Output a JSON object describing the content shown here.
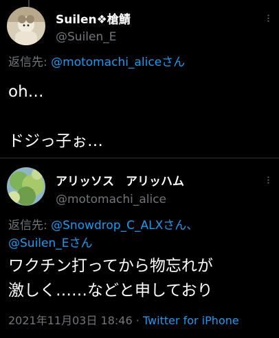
{
  "tweets": [
    {
      "display_name": "Suilen❖槍鯖",
      "handle": "@Suilen_E",
      "reply_prefix": "返信先: ",
      "reply_mentions": [
        "@motomachi_aliceさん"
      ],
      "body_lines": [
        "oh…",
        "",
        "ドジっ子ぉ…"
      ],
      "more": "···"
    },
    {
      "display_name": "アリッソス　アリッハム",
      "handle": "@motomachi_alice",
      "reply_prefix": "返信先: ",
      "reply_mentions": [
        "@Snowdrop_C_ALXさん、",
        "@Suilen_Eさん"
      ],
      "body_lines": [
        "ワクチン打ってから物忘れが",
        "激しく……などと申しており"
      ],
      "timestamp": "2021年11月03日 18:46",
      "separator": " · ",
      "source": "Twitter for iPhone",
      "more": "···"
    }
  ],
  "colors": {
    "background": "#000000",
    "text": "#ffffff",
    "secondary": "#71767b",
    "accent": "#1d9bf0",
    "divider": "#2f3336"
  }
}
